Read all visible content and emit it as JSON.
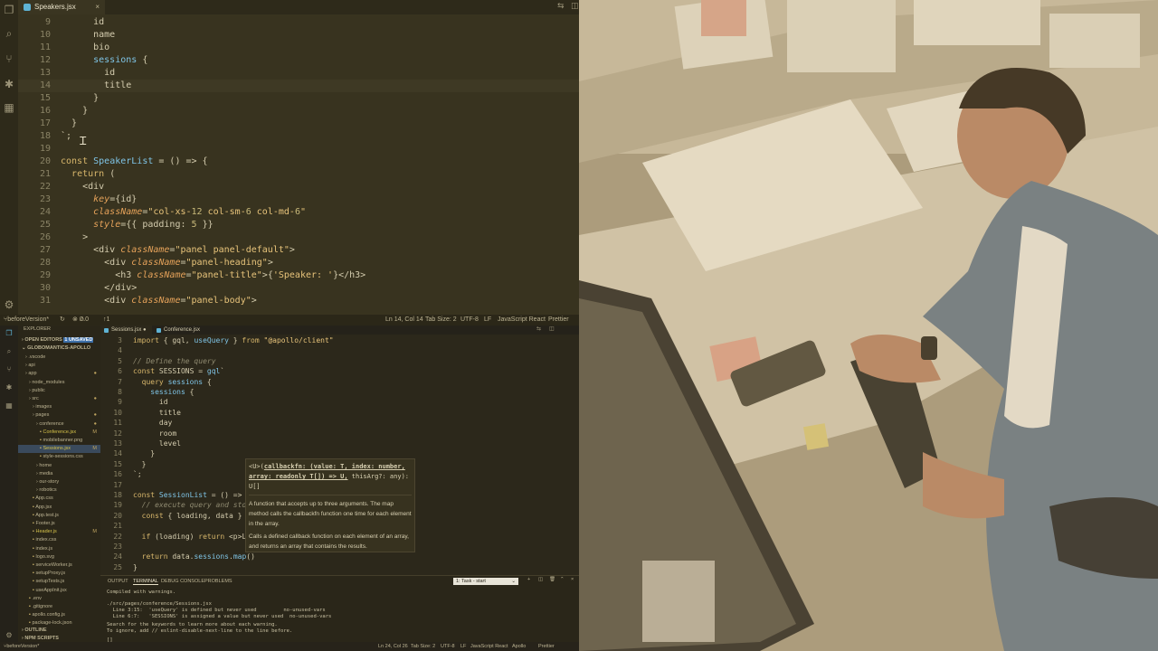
{
  "top_editor": {
    "tab_label": "Speakers.jsx",
    "code_lines": [
      {
        "n": "9",
        "html": "      id"
      },
      {
        "n": "10",
        "html": "      name"
      },
      {
        "n": "11",
        "html": "      bio"
      },
      {
        "n": "12",
        "html": "      sessions {"
      },
      {
        "n": "13",
        "html": "        id"
      },
      {
        "n": "14",
        "html": "        title"
      },
      {
        "n": "15",
        "html": "      }"
      },
      {
        "n": "16",
        "html": "    }"
      },
      {
        "n": "17",
        "html": "  }"
      },
      {
        "n": "18",
        "html": "`;"
      },
      {
        "n": "19",
        "html": ""
      },
      {
        "n": "20",
        "html": "const SpeakerList = () => {"
      },
      {
        "n": "21",
        "html": "  return ("
      },
      {
        "n": "22",
        "html": "    <div"
      },
      {
        "n": "23",
        "html": "      key={id}"
      },
      {
        "n": "24",
        "html": "      className=\"col-xs-12 col-sm-6 col-md-6\""
      },
      {
        "n": "25",
        "html": "      style={{ padding: 5 }}"
      },
      {
        "n": "26",
        "html": "    >"
      },
      {
        "n": "27",
        "html": "      <div className=\"panel panel-default\">"
      },
      {
        "n": "28",
        "html": "        <div className=\"panel-heading\">"
      },
      {
        "n": "29",
        "html": "          <h3 className=\"panel-title\">{'Speaker: '}</h3>"
      },
      {
        "n": "30",
        "html": "        </div>"
      },
      {
        "n": "31",
        "html": "        <div className=\"panel-body\">"
      }
    ],
    "status": {
      "branch": "beforeVersion*",
      "errors": "0",
      "warnings": "0",
      "sync": "1",
      "cursor": "Ln 14, Col 14",
      "tab_size": "Tab Size: 2",
      "encoding": "UTF-8",
      "eol": "LF",
      "language": "JavaScript React",
      "formatter": "Prettier"
    }
  },
  "bottom_editor": {
    "tabs": [
      "Sessions.jsx",
      "Conference.jsx"
    ],
    "explorer": {
      "header": "EXPLORER",
      "open_editors": "OPEN EDITORS",
      "unsaved": "1 UNSAVED",
      "project": "GLOBOMANTICS-APOLLO",
      "items": [
        {
          "label": ".vscode",
          "indent": 1,
          "mark": ""
        },
        {
          "label": "api",
          "indent": 1,
          "mark": ""
        },
        {
          "label": "app",
          "indent": 1,
          "mark": "●"
        },
        {
          "label": "node_modules",
          "indent": 2,
          "mark": ""
        },
        {
          "label": "public",
          "indent": 2,
          "mark": ""
        },
        {
          "label": "src",
          "indent": 2,
          "mark": "●"
        },
        {
          "label": "images",
          "indent": 3,
          "mark": ""
        },
        {
          "label": "pages",
          "indent": 3,
          "mark": "●"
        },
        {
          "label": "conference",
          "indent": 4,
          "mark": "●"
        },
        {
          "label": "Conference.jsx",
          "indent": 5,
          "mark": "M"
        },
        {
          "label": "mobilebanner.png",
          "indent": 5,
          "mark": ""
        },
        {
          "label": "Sessions.jsx",
          "indent": 5,
          "mark": "M"
        },
        {
          "label": "style-sessions.css",
          "indent": 5,
          "mark": ""
        },
        {
          "label": "home",
          "indent": 4,
          "mark": ""
        },
        {
          "label": "media",
          "indent": 4,
          "mark": ""
        },
        {
          "label": "our-story",
          "indent": 4,
          "mark": ""
        },
        {
          "label": "robotics",
          "indent": 4,
          "mark": ""
        },
        {
          "label": "App.css",
          "indent": 3,
          "mark": ""
        },
        {
          "label": "App.jsx",
          "indent": 3,
          "mark": ""
        },
        {
          "label": "App.test.js",
          "indent": 3,
          "mark": ""
        },
        {
          "label": "Footer.js",
          "indent": 3,
          "mark": ""
        },
        {
          "label": "Header.js",
          "indent": 3,
          "mark": "M"
        },
        {
          "label": "index.css",
          "indent": 3,
          "mark": ""
        },
        {
          "label": "index.js",
          "indent": 3,
          "mark": ""
        },
        {
          "label": "logo.svg",
          "indent": 3,
          "mark": ""
        },
        {
          "label": "serviceWorker.js",
          "indent": 3,
          "mark": ""
        },
        {
          "label": "setupProxy.js",
          "indent": 3,
          "mark": ""
        },
        {
          "label": "setupTests.js",
          "indent": 3,
          "mark": ""
        },
        {
          "label": "useAppInit.jsx",
          "indent": 3,
          "mark": ""
        },
        {
          "label": ".env",
          "indent": 2,
          "mark": ""
        },
        {
          "label": ".gitignore",
          "indent": 2,
          "mark": ""
        },
        {
          "label": "apollo.config.js",
          "indent": 2,
          "mark": ""
        },
        {
          "label": "package-lock.json",
          "indent": 2,
          "mark": ""
        }
      ],
      "outline": "OUTLINE",
      "npm_scripts": "NPM SCRIPTS"
    },
    "code_lines": [
      {
        "n": "3",
        "html": "import { gql, useQuery } from \"@apollo/client\""
      },
      {
        "n": "4",
        "html": ""
      },
      {
        "n": "5",
        "html": "// Define the query"
      },
      {
        "n": "6",
        "html": "const SESSIONS = gql`"
      },
      {
        "n": "7",
        "html": "  query sessions {"
      },
      {
        "n": "8",
        "html": "    sessions {"
      },
      {
        "n": "9",
        "html": "      id"
      },
      {
        "n": "10",
        "html": "      title"
      },
      {
        "n": "11",
        "html": "      day"
      },
      {
        "n": "12",
        "html": "      room"
      },
      {
        "n": "13",
        "html": "      level"
      },
      {
        "n": "14",
        "html": "    }"
      },
      {
        "n": "15",
        "html": "  }"
      },
      {
        "n": "16",
        "html": "`;"
      },
      {
        "n": "17",
        "html": ""
      },
      {
        "n": "18",
        "html": "const SessionList = () => {"
      },
      {
        "n": "19",
        "html": "  // execute query and stor"
      },
      {
        "n": "20",
        "html": "  const { loading, data } ="
      },
      {
        "n": "21",
        "html": ""
      },
      {
        "n": "22",
        "html": "  if (loading) return <p>Lo"
      },
      {
        "n": "23",
        "html": ""
      },
      {
        "n": "24",
        "html": "  return data.sessions.map()"
      },
      {
        "n": "25",
        "html": "}"
      }
    ],
    "hover": {
      "signature_head": "<U>(",
      "signature_bold": "callbackfn: (value: T, index: number, array: readonly T[]) => U,",
      "signature_tail": " thisArg?: any): U[]",
      "desc1": "A function that accepts up to three arguments. The map method calls the callbackfn function one time for each element in the array.",
      "desc2": "Calls a defined callback function on each element of an array, and returns an array that contains the results."
    },
    "panel": {
      "tabs": [
        "OUTPUT",
        "TERMINAL",
        "DEBUG CONSOLE",
        "PROBLEMS"
      ],
      "active_tab": "TERMINAL",
      "task_select": "1: Task - start",
      "lines": [
        "Compiled with warnings.",
        "./src/pages/conference/Sessions.jsx",
        "  Line 3:15:  'useQuery' is defined but never used         no-unused-vars",
        "  Line 6:7:   'SESSIONS' is assigned a value but never used  no-unused-vars",
        "Search for the keywords to learn more about each warning.",
        "To ignore, add // eslint-disable-next-line to the line before."
      ],
      "prompt": "[]"
    },
    "status": {
      "branch": "beforeVersion*",
      "cursor": "Ln 24, Col 26",
      "tab_size": "Tab Size: 2",
      "encoding": "UTF-8",
      "eol": "LF",
      "language": "JavaScript React",
      "extra": "Apollo",
      "formatter": "Prettier"
    }
  },
  "colors": {
    "editor_bg": "#38331f",
    "keyword": "#d7b66b",
    "function": "#7fc4e6",
    "string": "#e8c47b",
    "attribute": "#e5a25a"
  }
}
